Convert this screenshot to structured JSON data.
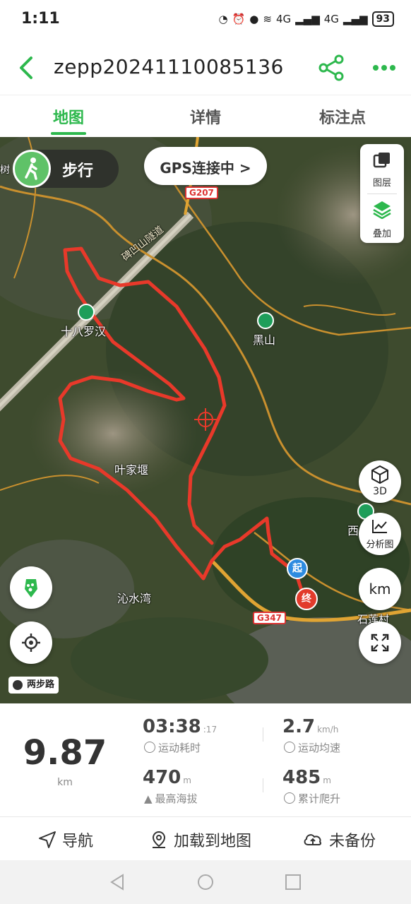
{
  "status_bar": {
    "time": "1:11",
    "network": "4G",
    "battery": "93"
  },
  "header": {
    "title": "zepp20241110085136"
  },
  "tabs": [
    {
      "label": "地图",
      "active": true
    },
    {
      "label": "详情",
      "active": false
    },
    {
      "label": "标注点",
      "active": false
    }
  ],
  "map": {
    "mode_label": "步行",
    "gps_label": "GPS连接中 >",
    "layers_label": "图层",
    "overlay_label": "叠加",
    "btn_3d": "3D",
    "btn_analysis": "分析图",
    "btn_unit": "km",
    "place_labels": {
      "shibaluohan": "十八罗汉",
      "heishan": "黑山",
      "yejiayan": "叶家堰",
      "qinshuiwan": "沁水湾",
      "shilian": "石莲村",
      "xi": "西",
      "cun": "树",
      "tunnel": "碑凹山隧道"
    },
    "road_signs": {
      "g207": "G207",
      "g347": "G347"
    },
    "start_marker": "起",
    "end_marker": "终",
    "scale_badge": "两步路",
    "accent_color": "#2db84d",
    "track_color": "#e8392a"
  },
  "stats": {
    "distance_value": "9.87",
    "distance_unit": "km",
    "duration_value": "03:38",
    "duration_seconds": ":17",
    "duration_label": "运动耗时",
    "avg_speed_value": "2.7",
    "avg_speed_unit": "km/h",
    "avg_speed_label": "运动均速",
    "max_alt_value": "470",
    "max_alt_unit": "m",
    "max_alt_label": "最高海拔",
    "climb_value": "485",
    "climb_unit": "m",
    "climb_label": "累计爬升"
  },
  "actions": {
    "navigate": "导航",
    "load_to_map": "加载到地图",
    "backup": "未备份"
  }
}
